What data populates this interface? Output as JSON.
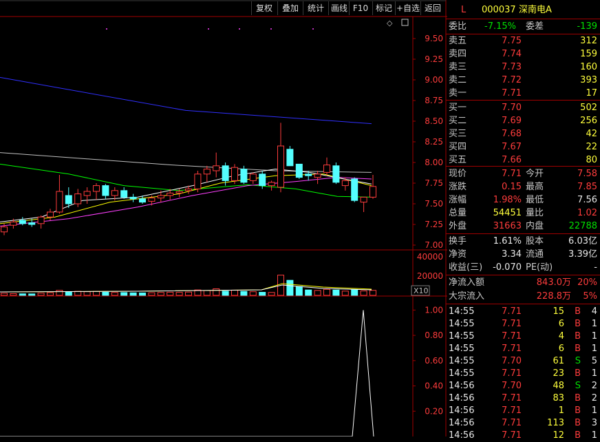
{
  "toolbar": {
    "buttons": [
      "复权",
      "叠加",
      "统计",
      "画线",
      "F10",
      "标记",
      "+自选",
      "返回"
    ]
  },
  "chart": {
    "price_axis": [
      "9.50",
      "9.25",
      "9.00",
      "8.75",
      "8.50",
      "8.25",
      "8.00",
      "7.75",
      "7.50",
      "7.25",
      "7.00"
    ],
    "volume_axis": [
      "40000",
      "20000"
    ],
    "volume_unit": "X10",
    "indicator_axis": [
      "1.00",
      "0.80",
      "0.60",
      "0.40",
      "0.20"
    ],
    "price_range": [
      6.95,
      9.75
    ],
    "indicator_range": [
      0,
      1.1
    ],
    "volume_max": 45000,
    "colors": {
      "up": "#ff3c3c",
      "down": "#54ffff",
      "ma_white": "#ffffff",
      "ma_yellow": "#ffff00",
      "ma_magenta": "#ff40ff",
      "ma_green": "#00ff00",
      "ma_gray": "#c0c0c0",
      "ma_blue": "#3030ff",
      "grid": "#a00000"
    }
  },
  "chart_data": {
    "type": "candlestick",
    "candles": [
      {
        "o": 7.16,
        "h": 7.26,
        "l": 7.12,
        "c": 7.22
      },
      {
        "o": 7.24,
        "h": 7.32,
        "l": 7.2,
        "c": 7.28
      },
      {
        "o": 7.3,
        "h": 7.34,
        "l": 7.24,
        "c": 7.26
      },
      {
        "o": 7.27,
        "h": 7.32,
        "l": 7.22,
        "c": 7.25
      },
      {
        "o": 7.26,
        "h": 7.36,
        "l": 7.2,
        "c": 7.34
      },
      {
        "o": 7.34,
        "h": 7.44,
        "l": 7.3,
        "c": 7.4
      },
      {
        "o": 7.4,
        "h": 7.85,
        "l": 7.38,
        "c": 7.65
      },
      {
        "o": 7.6,
        "h": 7.7,
        "l": 7.45,
        "c": 7.5
      },
      {
        "o": 7.5,
        "h": 7.68,
        "l": 7.46,
        "c": 7.62
      },
      {
        "o": 7.6,
        "h": 7.7,
        "l": 7.5,
        "c": 7.65
      },
      {
        "o": 7.65,
        "h": 7.75,
        "l": 7.55,
        "c": 7.72
      },
      {
        "o": 7.72,
        "h": 7.74,
        "l": 7.56,
        "c": 7.6
      },
      {
        "o": 7.6,
        "h": 7.7,
        "l": 7.54,
        "c": 7.66
      },
      {
        "o": 7.66,
        "h": 7.7,
        "l": 7.56,
        "c": 7.58
      },
      {
        "o": 7.58,
        "h": 7.62,
        "l": 7.52,
        "c": 7.56
      },
      {
        "o": 7.56,
        "h": 7.6,
        "l": 7.5,
        "c": 7.52
      },
      {
        "o": 7.53,
        "h": 7.6,
        "l": 7.48,
        "c": 7.57
      },
      {
        "o": 7.57,
        "h": 7.66,
        "l": 7.52,
        "c": 7.6
      },
      {
        "o": 7.6,
        "h": 7.68,
        "l": 7.55,
        "c": 7.63
      },
      {
        "o": 7.63,
        "h": 7.68,
        "l": 7.58,
        "c": 7.65
      },
      {
        "o": 7.66,
        "h": 7.72,
        "l": 7.62,
        "c": 7.68
      },
      {
        "o": 7.68,
        "h": 7.9,
        "l": 7.64,
        "c": 7.86
      },
      {
        "o": 7.86,
        "h": 7.96,
        "l": 7.76,
        "c": 7.92
      },
      {
        "o": 7.9,
        "h": 8.12,
        "l": 7.82,
        "c": 7.96
      },
      {
        "o": 7.96,
        "h": 8.0,
        "l": 7.72,
        "c": 7.78
      },
      {
        "o": 7.78,
        "h": 7.98,
        "l": 7.74,
        "c": 7.94
      },
      {
        "o": 7.92,
        "h": 7.96,
        "l": 7.74,
        "c": 7.76
      },
      {
        "o": 7.78,
        "h": 7.88,
        "l": 7.74,
        "c": 7.86
      },
      {
        "o": 7.86,
        "h": 7.9,
        "l": 7.68,
        "c": 7.72
      },
      {
        "o": 7.72,
        "h": 7.78,
        "l": 7.66,
        "c": 7.76
      },
      {
        "o": 7.7,
        "h": 8.48,
        "l": 7.64,
        "c": 8.2
      },
      {
        "o": 8.16,
        "h": 8.2,
        "l": 7.96,
        "c": 7.96
      },
      {
        "o": 7.98,
        "h": 7.98,
        "l": 7.8,
        "c": 7.82
      },
      {
        "o": 7.86,
        "h": 7.9,
        "l": 7.78,
        "c": 7.84
      },
      {
        "o": 7.82,
        "h": 7.9,
        "l": 7.74,
        "c": 7.86
      },
      {
        "o": 7.88,
        "h": 8.06,
        "l": 7.84,
        "c": 7.97
      },
      {
        "o": 7.96,
        "h": 8.0,
        "l": 7.74,
        "c": 7.76
      },
      {
        "o": 7.72,
        "h": 7.82,
        "l": 7.66,
        "c": 7.78
      },
      {
        "o": 7.8,
        "h": 7.82,
        "l": 7.52,
        "c": 7.54
      },
      {
        "o": 7.52,
        "h": 7.58,
        "l": 7.4,
        "c": 7.58
      },
      {
        "o": 7.58,
        "h": 7.85,
        "l": 7.56,
        "c": 7.71
      }
    ],
    "volume": [
      2200,
      1800,
      1600,
      1500,
      2300,
      2800,
      5200,
      3600,
      4200,
      3800,
      4100,
      3200,
      3000,
      2900,
      2600,
      2500,
      2700,
      3000,
      3300,
      3100,
      3400,
      5600,
      5000,
      6800,
      4300,
      5400,
      4100,
      3800,
      3200,
      3000,
      21000,
      15600,
      9200,
      5600,
      5100,
      6300,
      5500,
      4400,
      6000,
      4600,
      5200
    ],
    "ma_blue": [
      [
        0,
        9.03
      ],
      [
        270,
        8.63
      ],
      [
        540,
        8.47
      ]
    ],
    "ma_gray": [
      [
        0,
        8.12
      ],
      [
        250,
        7.97
      ],
      [
        400,
        7.9
      ],
      [
        540,
        7.88
      ]
    ],
    "ma_green": [
      [
        0,
        7.98
      ],
      [
        100,
        7.86
      ],
      [
        180,
        7.72
      ],
      [
        260,
        7.66
      ],
      [
        360,
        7.73
      ],
      [
        430,
        7.68
      ],
      [
        490,
        7.59
      ],
      [
        540,
        7.58
      ]
    ],
    "ma_magenta": [
      [
        0,
        7.23
      ],
      [
        100,
        7.32
      ],
      [
        200,
        7.46
      ],
      [
        280,
        7.6
      ],
      [
        360,
        7.72
      ],
      [
        430,
        7.77
      ],
      [
        490,
        7.82
      ],
      [
        540,
        7.8
      ]
    ],
    "ma_yellow": [
      [
        0,
        7.26
      ],
      [
        80,
        7.34
      ],
      [
        160,
        7.52
      ],
      [
        260,
        7.62
      ],
      [
        320,
        7.75
      ],
      [
        400,
        7.84
      ],
      [
        470,
        7.86
      ],
      [
        540,
        7.72
      ]
    ],
    "ma_white": [
      [
        0,
        7.28
      ],
      [
        60,
        7.34
      ],
      [
        120,
        7.54
      ],
      [
        200,
        7.58
      ],
      [
        280,
        7.72
      ],
      [
        340,
        7.84
      ],
      [
        400,
        7.92
      ],
      [
        450,
        7.88
      ],
      [
        500,
        7.8
      ],
      [
        540,
        7.74
      ]
    ],
    "indicator": [
      [
        0,
        0
      ],
      [
        512,
        0
      ],
      [
        528,
        1.0
      ],
      [
        543,
        0
      ]
    ]
  },
  "quote": {
    "market": "L",
    "code": "000037",
    "name": "深南电A",
    "wb_label": "委比",
    "wb_value": "-7.15%",
    "wc_label": "委差",
    "wc_value": "-139",
    "asks": [
      {
        "label": "卖五",
        "price": "7.75",
        "vol": "312"
      },
      {
        "label": "卖四",
        "price": "7.74",
        "vol": "159"
      },
      {
        "label": "卖三",
        "price": "7.73",
        "vol": "160"
      },
      {
        "label": "卖二",
        "price": "7.72",
        "vol": "393"
      },
      {
        "label": "卖一",
        "price": "7.71",
        "vol": "17"
      }
    ],
    "bids": [
      {
        "label": "买一",
        "price": "7.70",
        "vol": "502"
      },
      {
        "label": "买二",
        "price": "7.69",
        "vol": "256"
      },
      {
        "label": "买三",
        "price": "7.68",
        "vol": "42"
      },
      {
        "label": "买四",
        "price": "7.67",
        "vol": "22"
      },
      {
        "label": "买五",
        "price": "7.66",
        "vol": "80"
      }
    ],
    "stats": [
      {
        "l1": "现价",
        "v1": "7.71",
        "c1": "red",
        "l2": "今开",
        "v2": "7.58",
        "c2": "red"
      },
      {
        "l1": "涨跌",
        "v1": "0.15",
        "c1": "red",
        "l2": "最高",
        "v2": "7.85",
        "c2": "red"
      },
      {
        "l1": "涨幅",
        "v1": "1.98%",
        "c1": "red",
        "l2": "最低",
        "v2": "7.56",
        "c2": "wht"
      },
      {
        "l1": "总量",
        "v1": "54451",
        "c1": "yel",
        "l2": "量比",
        "v2": "1.02",
        "c2": "red"
      },
      {
        "l1": "外盘",
        "v1": "31663",
        "c1": "red",
        "l2": "内盘",
        "v2": "22788",
        "c2": "grn"
      }
    ],
    "fund": [
      {
        "l1": "换手",
        "v1": "1.61%",
        "l2": "股本",
        "v2": "6.03亿"
      },
      {
        "l1": "净资",
        "v1": "3.34",
        "l2": "流通",
        "v2": "3.39亿"
      },
      {
        "l1": "收益(三)",
        "v1": "-0.070",
        "l2": "PE(动)",
        "v2": "-"
      }
    ],
    "flow": [
      {
        "label": "净流入额",
        "value": "843.0万",
        "pct": "20%"
      },
      {
        "label": "大宗流入",
        "value": "228.8万",
        "pct": "5%"
      }
    ],
    "ticks": [
      {
        "t": "14:55",
        "p": "7.71",
        "v": "15",
        "s": "B",
        "n": "4"
      },
      {
        "t": "14:55",
        "p": "7.71",
        "v": "6",
        "s": "B",
        "n": "1"
      },
      {
        "t": "14:55",
        "p": "7.71",
        "v": "4",
        "s": "B",
        "n": "1"
      },
      {
        "t": "14:55",
        "p": "7.71",
        "v": "6",
        "s": "B",
        "n": "1"
      },
      {
        "t": "14:55",
        "p": "7.70",
        "v": "61",
        "s": "S",
        "n": "5"
      },
      {
        "t": "14:55",
        "p": "7.71",
        "v": "23",
        "s": "B",
        "n": "1"
      },
      {
        "t": "14:56",
        "p": "7.70",
        "v": "48",
        "s": "S",
        "n": "2"
      },
      {
        "t": "14:56",
        "p": "7.71",
        "v": "83",
        "s": "B",
        "n": "2"
      },
      {
        "t": "14:56",
        "p": "7.71",
        "v": "1",
        "s": "B",
        "n": "1"
      },
      {
        "t": "14:56",
        "p": "7.71",
        "v": "113",
        "s": "B",
        "n": "3"
      },
      {
        "t": "14:56",
        "p": "7.71",
        "v": "12",
        "s": "B",
        "n": "1"
      }
    ]
  }
}
